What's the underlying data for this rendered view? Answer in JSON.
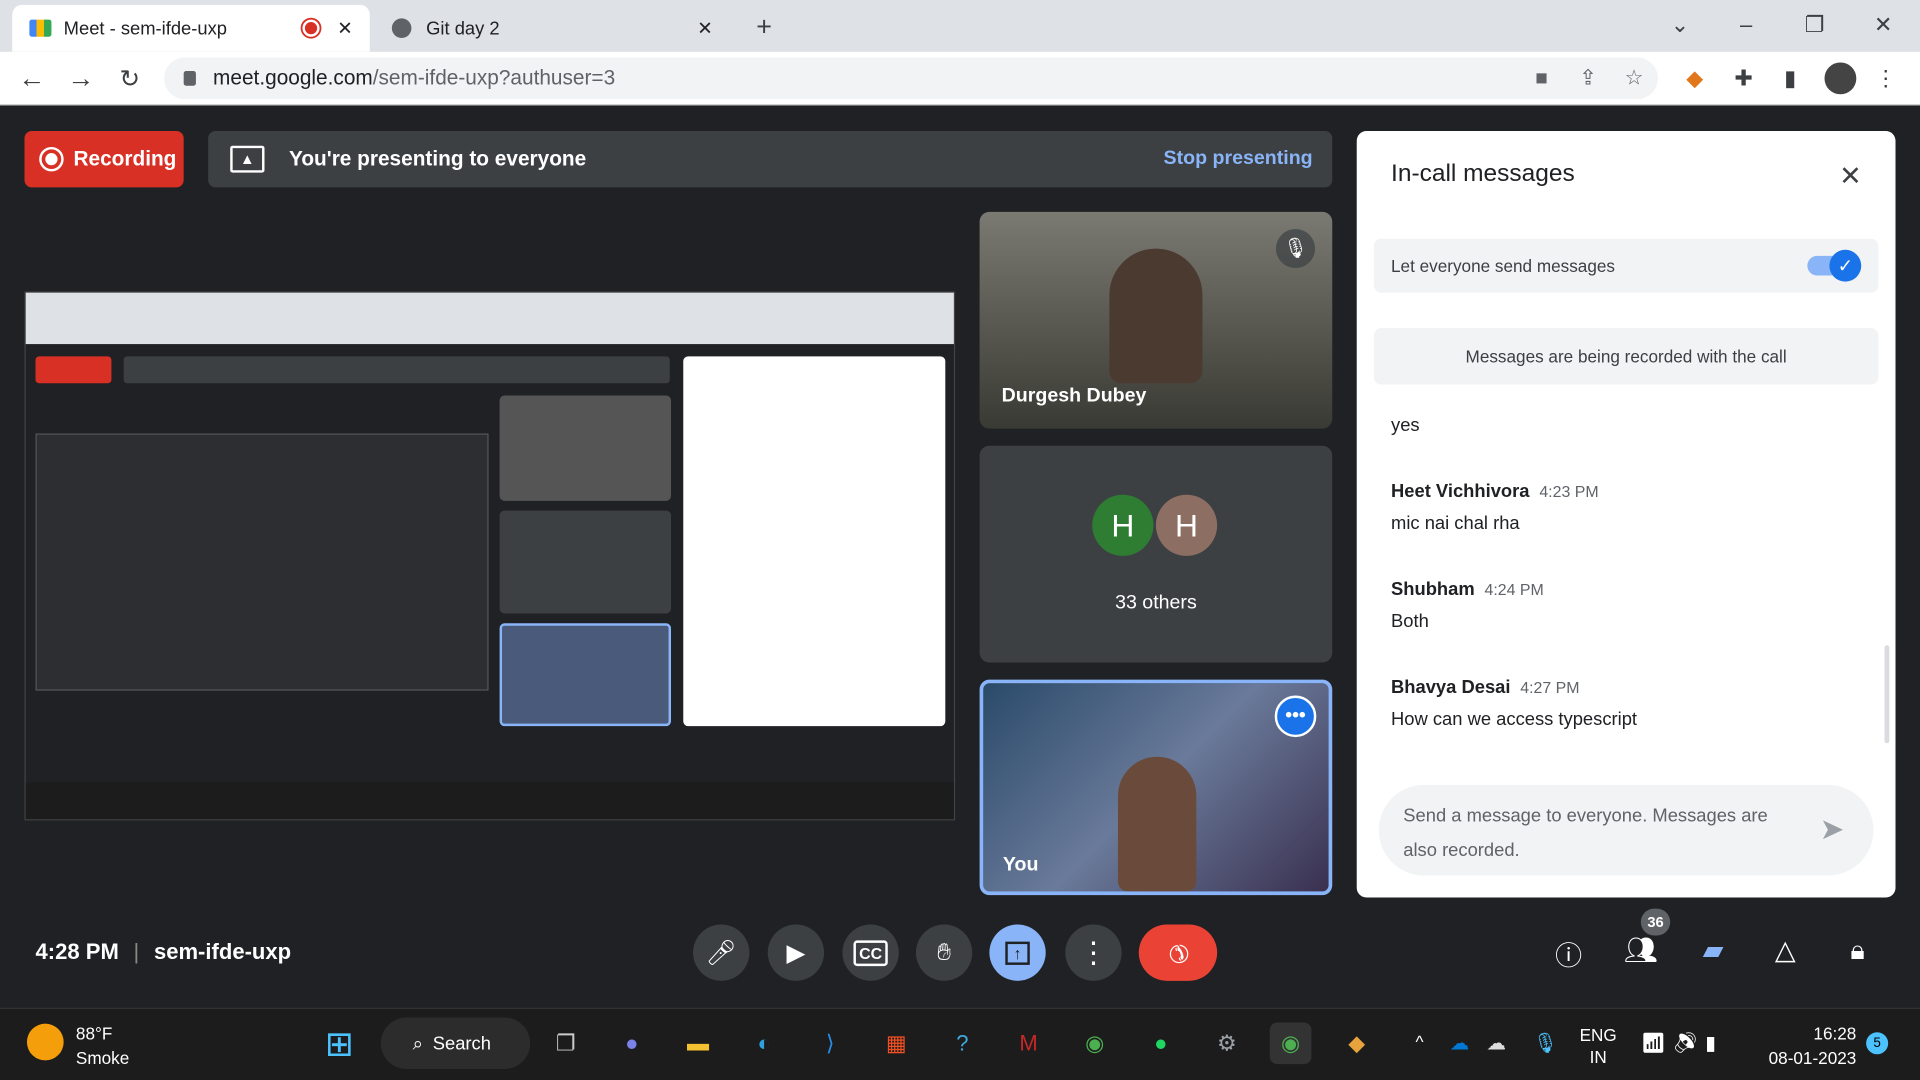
{
  "browser": {
    "tabs": [
      {
        "title": "Meet - sem-ifde-uxp",
        "active": true,
        "recording": true
      },
      {
        "title": "Git day 2",
        "active": false
      }
    ],
    "url_host": "meet.google.com",
    "url_path": "/sem-ifde-uxp?authuser=3"
  },
  "banner": {
    "recording": "Recording",
    "presenting": "You're presenting to everyone",
    "stop": "Stop presenting"
  },
  "tiles": {
    "participant1": "Durgesh Dubey",
    "others_avatars": [
      {
        "letter": "H",
        "color": "#2e7d32"
      },
      {
        "letter": "H",
        "color": "#8d6e63"
      }
    ],
    "others_label": "33 others",
    "self": "You"
  },
  "chat": {
    "title": "In-call messages",
    "toggle_label": "Let everyone send messages",
    "toggle_on": true,
    "notice": "Messages are being recorded with the call",
    "messages": [
      {
        "name": "",
        "time": "",
        "text": "yes"
      },
      {
        "name": "Heet Vichhivora",
        "time": "4:23 PM",
        "text": "mic nai chal rha"
      },
      {
        "name": "Shubham",
        "time": "4:24 PM",
        "text": "Both"
      },
      {
        "name": "Bhavya Desai",
        "time": "4:27 PM",
        "text": "How can we access typescript"
      }
    ],
    "input_placeholder": "Send a message to everyone. Messages are also recorded."
  },
  "footer": {
    "time": "4:28 PM",
    "meeting_code": "sem-ifde-uxp",
    "participant_count": "36"
  },
  "taskbar": {
    "weather_temp": "88°F",
    "weather_desc": "Smoke",
    "search": "Search",
    "lang1": "ENG",
    "lang2": "IN",
    "clock_time": "16:28",
    "clock_date": "08-01-2023",
    "notifications": "5"
  },
  "colors": {
    "accent": "#8ab4f8",
    "danger": "#ea4335",
    "recording": "#d93025"
  }
}
